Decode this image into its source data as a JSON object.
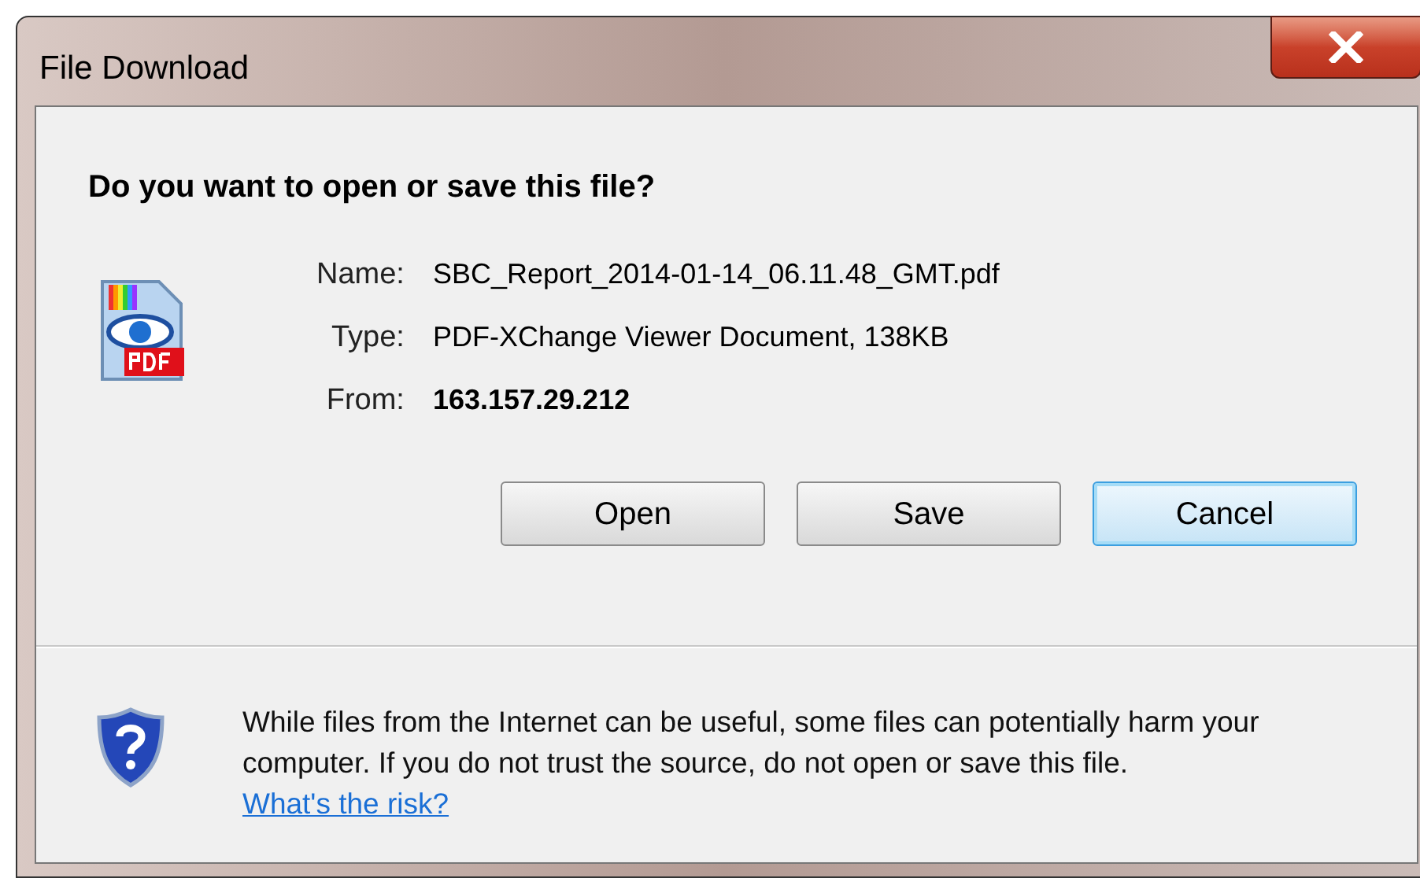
{
  "window": {
    "title": "File Download"
  },
  "question": "Do you want to open or save this file?",
  "fields": [
    {
      "label": "Name:",
      "value": "SBC_Report_2014-01-14_06.11.48_GMT.pdf",
      "bold": false
    },
    {
      "label": "Type:",
      "value": "PDF-XChange Viewer Document, 138KB",
      "bold": false
    },
    {
      "label": "From:",
      "value": "163.157.29.212",
      "bold": true
    }
  ],
  "buttons": [
    {
      "label": "Open",
      "default": false
    },
    {
      "label": "Save",
      "default": false
    },
    {
      "label": "Cancel",
      "default": true
    }
  ],
  "warning": {
    "text": "While files from the Internet can be useful, some files can potentially harm your computer. If you do not trust the source, do not open or save this file.",
    "link": "What's the risk?"
  }
}
